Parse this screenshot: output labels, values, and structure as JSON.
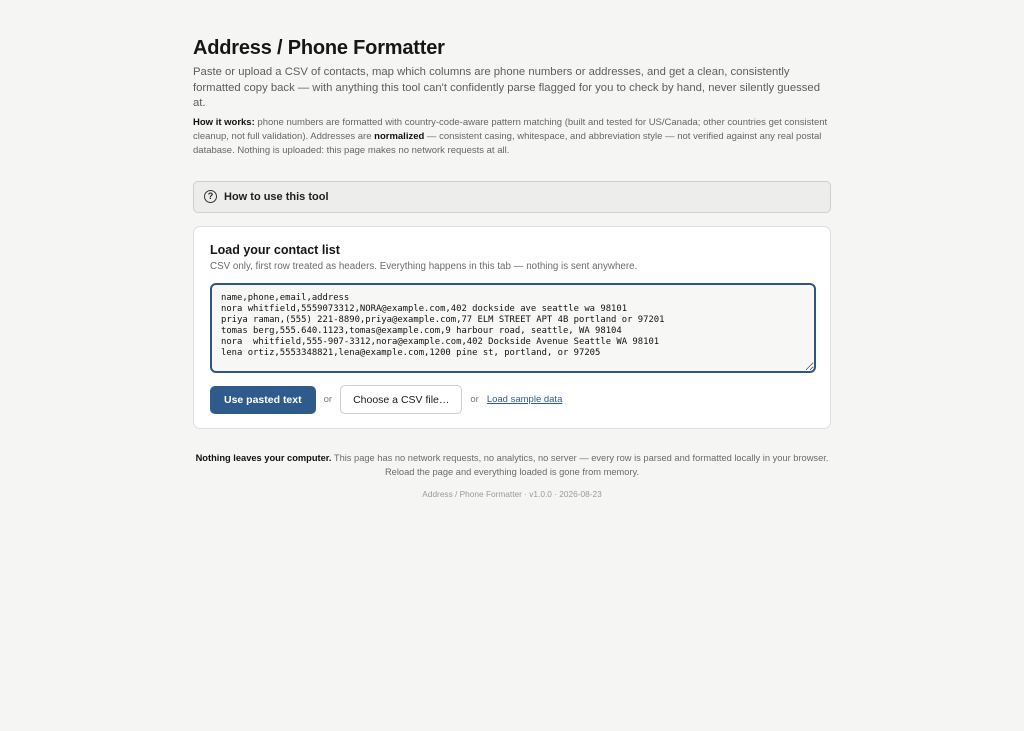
{
  "header": {
    "title": "Address / Phone Formatter",
    "subtitle": "Paste or upload a CSV of contacts, map which columns are phone numbers or addresses, and get a clean, consistently formatted copy back — with anything this tool can't confidently parse flagged for you to check by hand, never silently guessed at.",
    "how_label": "How it works:",
    "how_text_1": " phone numbers are formatted with country-code-aware pattern matching (built and tested for US/Canada; other countries get consistent cleanup, not full validation). Addresses are ",
    "how_bold": "normalized",
    "how_text_2": " — consistent casing, whitespace, and abbreviation style — not verified against any real postal database. Nothing is uploaded: this page makes no network requests at all."
  },
  "help_panel": {
    "icon": "?",
    "label": "How to use this tool"
  },
  "load_card": {
    "title": "Load your contact list",
    "description": "CSV only, first row treated as headers. Everything happens in this tab — nothing is sent anywhere.",
    "csv_text": "name,phone,email,address\nnora whitfield,5559073312,NORA@example.com,402 dockside ave seattle wa 98101\npriya raman,(555) 221-8890,priya@example.com,77 ELM STREET APT 4B portland or 97201\ntomas berg,555.640.1123,tomas@example.com,9 harbour road, seattle, WA 98104\nnora  whitfield,555-907-3312,nora@example.com,402 Dockside Avenue Seattle WA 98101\nlena ortiz,5553348821,lena@example.com,1200 pine st, portland, or 97205",
    "use_pasted_label": "Use pasted text",
    "or_1": "or",
    "choose_file_label": "Choose a CSV file…",
    "or_2": "or",
    "sample_link": "Load sample data"
  },
  "footer": {
    "privacy_bold": "Nothing leaves your computer.",
    "privacy_text": " This page has no network requests, no analytics, no server — every row is parsed and formatted locally in your browser. Reload the page and everything loaded is gone from memory.",
    "version": "Address / Phone Formatter · v1.0.0 · 2026-08-23"
  },
  "colors": {
    "accent": "#2e5b8c",
    "background": "#f5f5f3"
  }
}
